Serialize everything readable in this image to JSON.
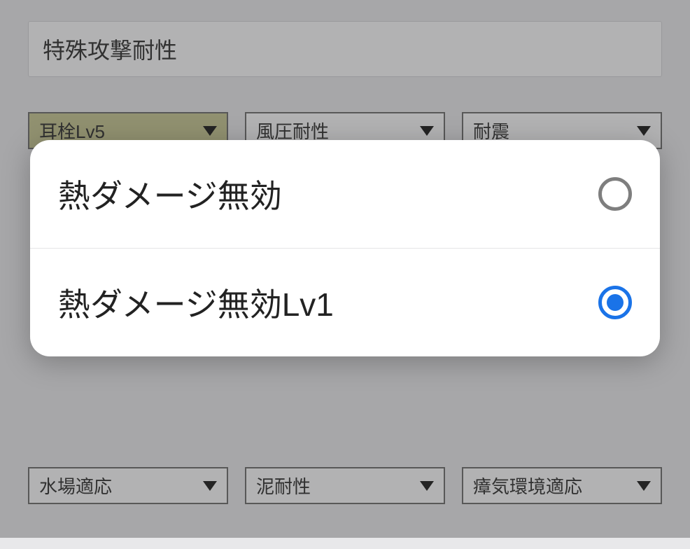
{
  "section": {
    "title": "特殊攻撃耐性"
  },
  "row1": {
    "d0": {
      "label": "耳栓Lv5"
    },
    "d1": {
      "label": "風圧耐性"
    },
    "d2": {
      "label": "耐震"
    }
  },
  "row2": {
    "d0": {
      "label": "水場適応"
    },
    "d1": {
      "label": "泥耐性"
    },
    "d2": {
      "label": "瘴気環境適応"
    }
  },
  "modal": {
    "option0": {
      "label": "熱ダメージ無効"
    },
    "option1": {
      "label": "熱ダメージ無効Lv1"
    }
  }
}
